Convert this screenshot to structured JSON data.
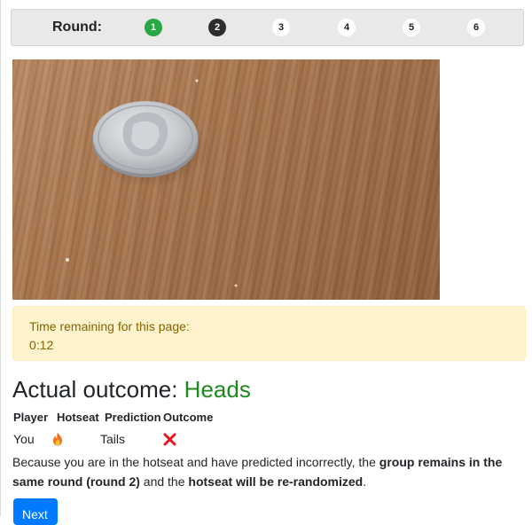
{
  "round_nav": {
    "label": "Round:",
    "rounds": [
      {
        "number": "1",
        "state": "completed",
        "color": "#28a745"
      },
      {
        "number": "2",
        "state": "current",
        "color": "#2b2d2f"
      },
      {
        "number": "3",
        "state": "upcoming"
      },
      {
        "number": "4",
        "state": "upcoming"
      },
      {
        "number": "5",
        "state": "upcoming"
      },
      {
        "number": "6",
        "state": "upcoming"
      }
    ]
  },
  "timer": {
    "label": "Time remaining for this page:",
    "value": "0:12"
  },
  "outcome": {
    "prefix": "Actual outcome:",
    "result": "Heads",
    "result_color": "#1e8a1e"
  },
  "results_table": {
    "headers": [
      "Player",
      "Hotseat",
      "Prediction",
      "Outcome"
    ],
    "row": {
      "player": "You",
      "hotseat_icon": "fire-icon",
      "prediction": "Tails",
      "outcome_icon": "x-icon"
    }
  },
  "message": {
    "part1": "Because you are in the hotseat and have predicted incorrectly, the ",
    "bold1": "group remains in the same round (round 2)",
    "part2": " and the ",
    "bold2": "hotseat will be re-randomized",
    "part3": "."
  },
  "next_button": {
    "label": "Next",
    "color": "#007bff"
  }
}
